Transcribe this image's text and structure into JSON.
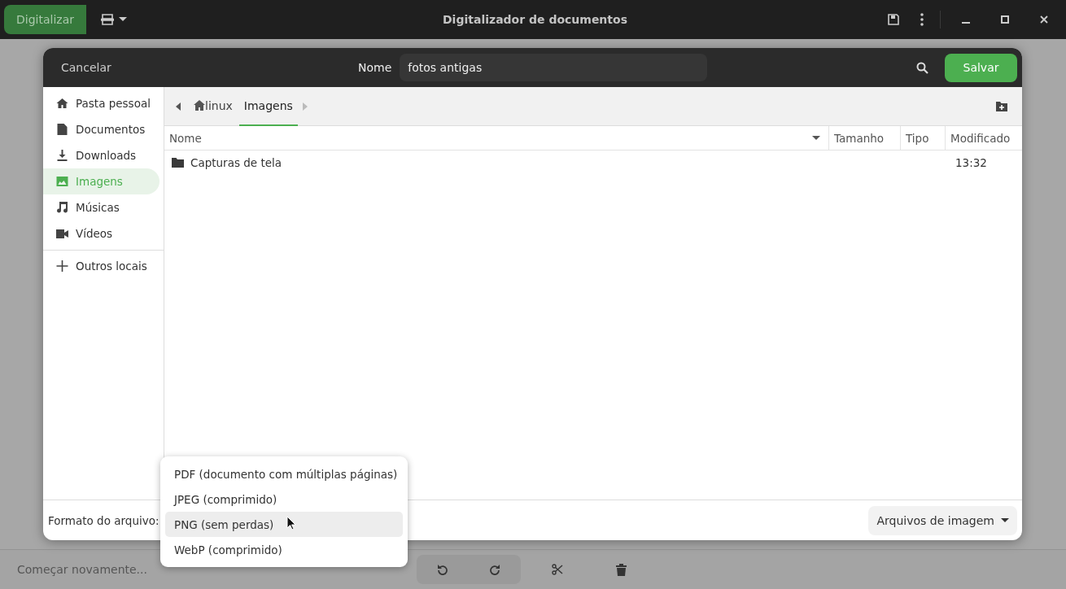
{
  "header": {
    "scan_button": "Digitalizar",
    "title": "Digitalizador de documentos"
  },
  "dialog": {
    "cancel": "Cancelar",
    "name_label": "Nome",
    "name_value": "fotos antigas",
    "save": "Salvar",
    "places": [
      {
        "label": "Pasta pessoal",
        "kind": "home",
        "selected": false
      },
      {
        "label": "Documentos",
        "kind": "document",
        "selected": false
      },
      {
        "label": "Downloads",
        "kind": "download",
        "selected": false
      },
      {
        "label": "Imagens",
        "kind": "image",
        "selected": true
      },
      {
        "label": "Músicas",
        "kind": "music",
        "selected": false
      },
      {
        "label": "Vídeos",
        "kind": "video",
        "selected": false
      }
    ],
    "other_places": "Outros locais",
    "path": [
      {
        "label": "linux",
        "kind": "home",
        "selected": false
      },
      {
        "label": "Imagens",
        "selected": true
      }
    ],
    "columns": [
      "Nome",
      "Tamanho",
      "Tipo",
      "Modificado"
    ],
    "rows": [
      {
        "name": "Capturas de tela",
        "modified": "13:32"
      }
    ],
    "format_label": "Formato do arquivo:",
    "filter": "Arquivos de imagem"
  },
  "format_menu": [
    {
      "label": "PDF (documento com múltiplas páginas)",
      "selected": false
    },
    {
      "label": "JPEG (comprimido)",
      "selected": false
    },
    {
      "label": "PNG (sem perdas)",
      "selected": true
    },
    {
      "label": "WebP (comprimido)",
      "selected": false
    }
  ],
  "bottom_bar": {
    "restart": "Começar novamente..."
  }
}
